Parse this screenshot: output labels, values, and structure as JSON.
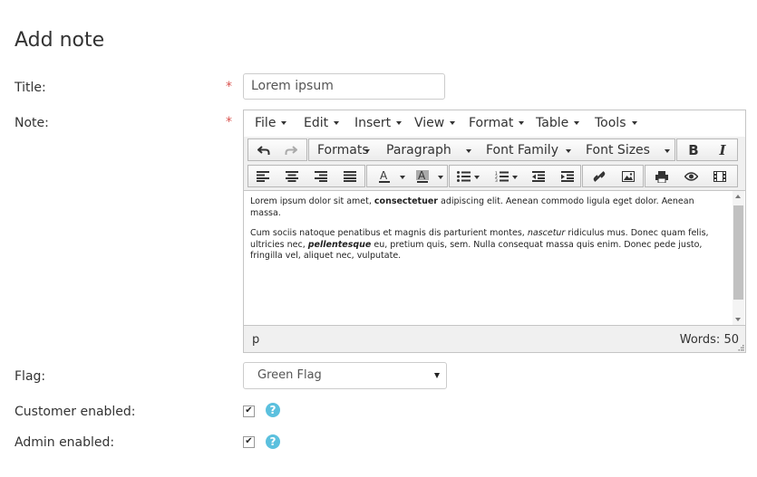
{
  "page": {
    "title": "Add note"
  },
  "form": {
    "title_label": "Title:",
    "title_required": "*",
    "title_value": "Lorem ipsum",
    "note_label": "Note:",
    "note_required": "*",
    "flag_label": "Flag:",
    "flag_value": "Green Flag",
    "customer_enabled_label": "Customer enabled:",
    "admin_enabled_label": "Admin enabled:",
    "customer_enabled_checked": true,
    "admin_enabled_checked": true
  },
  "editor": {
    "menu": [
      "File",
      "Edit",
      "Insert",
      "View",
      "Format",
      "Table",
      "Tools"
    ],
    "formats_label": "Formats",
    "paragraph_label": "Paragraph",
    "font_family_label": "Font Family",
    "font_sizes_label": "Font Sizes",
    "bold_label": "B",
    "italic_label": "I",
    "content": {
      "p1_a": "Lorem ipsum dolor sit amet, ",
      "p1_b": "consectetuer",
      "p1_c": " adipiscing elit. Aenean commodo ligula eget dolor. Aenean massa.",
      "p2_a": "Cum sociis natoque penatibus et magnis dis parturient montes, ",
      "p2_b": "nascetur",
      "p2_c": " ridiculus mus. Donec quam felis, ultricies nec, ",
      "p2_d": "pellentesque",
      "p2_e": " eu, pretium quis, sem. Nulla consequat massa quis enim. Donec pede justo, fringilla vel, aliquet nec, vulputate."
    },
    "status_path": "p",
    "word_count": "Words: 50"
  },
  "icons": {
    "help": "?",
    "check": "✔"
  },
  "colors": {
    "required": "#d9534f",
    "help": "#5bc0de"
  }
}
